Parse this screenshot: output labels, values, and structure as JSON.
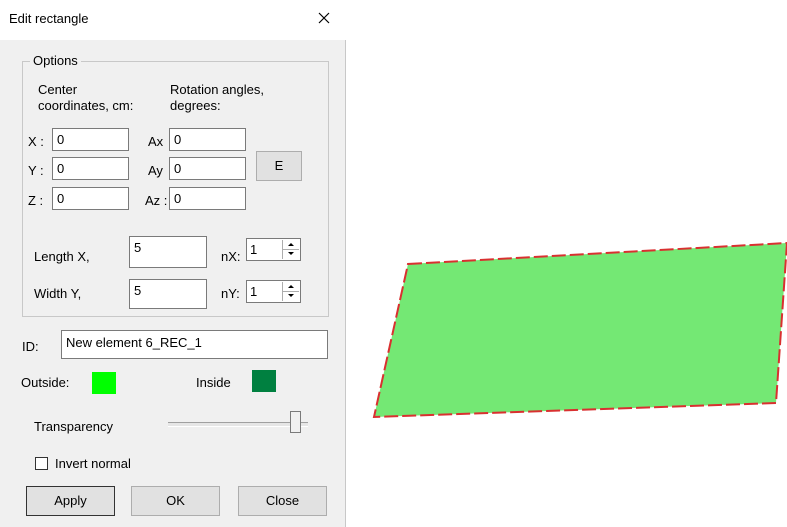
{
  "window": {
    "title": "Edit rectangle"
  },
  "options": {
    "group_label": "Options",
    "center_label_1": "Center",
    "center_label_2": "coordinates, cm:",
    "rotation_label_1": "Rotation angles,",
    "rotation_label_2": "degrees:",
    "x_label": "X :",
    "y_label": "Y :",
    "z_label": "Z :",
    "x_value": "0",
    "y_value": "0",
    "z_value": "0",
    "ax_label": "Ax",
    "ay_label": "Ay",
    "az_label": "Az :",
    "ax_value": "0",
    "ay_value": "0",
    "az_value": "0",
    "e_button": "E",
    "length_label": "Length X,",
    "length_value": "5",
    "width_label": "Width Y,",
    "width_value": "5",
    "nx_label": "nX:",
    "nx_value": "1",
    "ny_label": "nY:",
    "ny_value": "1"
  },
  "id_field": {
    "label": "ID:",
    "value": "New element 6_REC_1"
  },
  "colors": {
    "outside_label": "Outside:",
    "outside_color": "#00ff00",
    "inside_label": "Inside",
    "inside_color": "#008040"
  },
  "transparency": {
    "label": "Transparency",
    "level_fraction": 0.95
  },
  "invert_normal": {
    "label": "Invert normal",
    "checked": false
  },
  "buttons": {
    "apply": "Apply",
    "ok": "OK",
    "close": "Close"
  },
  "preview": {
    "fill_color": "#74e874",
    "edge_color": "#d93030"
  }
}
